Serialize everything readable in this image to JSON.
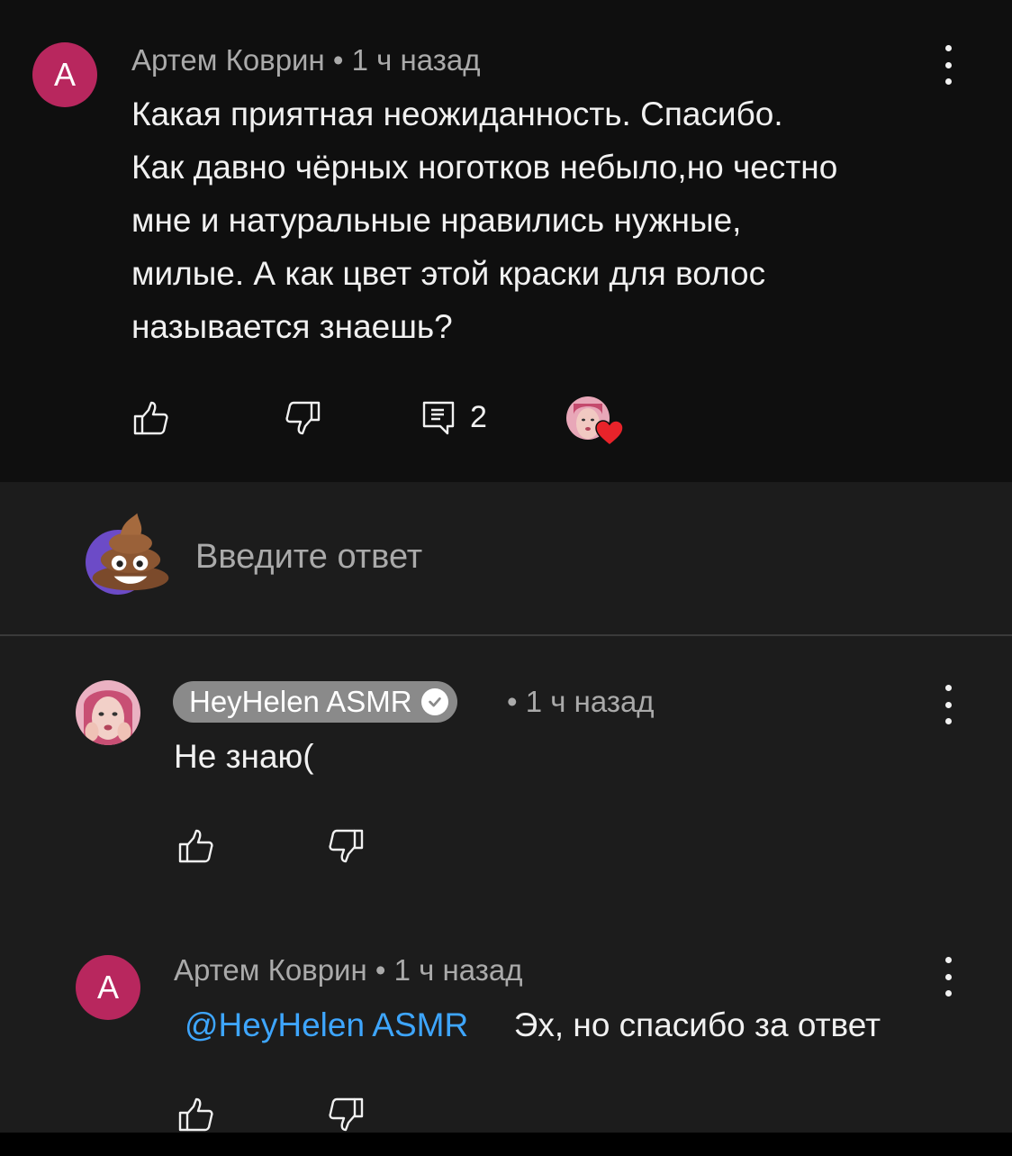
{
  "comment": {
    "avatar_letter": "А",
    "author": "Артем Коврин",
    "time": "1 ч назад",
    "text_lines": [
      "Какая приятная неожиданность. Спасибо.",
      "Как давно чёрных ноготков небыло,но честно",
      "мне и натуральные нравились нужные,",
      "милые. А как цвет этой краски для волос",
      "называется знаешь?"
    ],
    "reply_count": "2"
  },
  "reply_box": {
    "placeholder": "Введите ответ"
  },
  "replies": [
    {
      "author": "HeyHelen ASMR",
      "time": "1 ч назад",
      "text": "Не знаю("
    },
    {
      "avatar_letter": "А",
      "author": "Артем Коврин",
      "time": "1 ч назад",
      "mention": "@HeyHelen ASMR",
      "text": "Эх, но спасибо за ответ"
    }
  ],
  "colors": {
    "background_top": "#0f0f0f",
    "background_replies": "#1c1c1c",
    "avatar_letter_bg": "#b8275e",
    "mention": "#3ea6ff",
    "badge_bg": "#8a8a8a",
    "heart": "#e8232a"
  },
  "icons": [
    "like-icon",
    "dislike-icon",
    "reply-icon",
    "more-icon",
    "verified-icon",
    "heart-icon"
  ]
}
